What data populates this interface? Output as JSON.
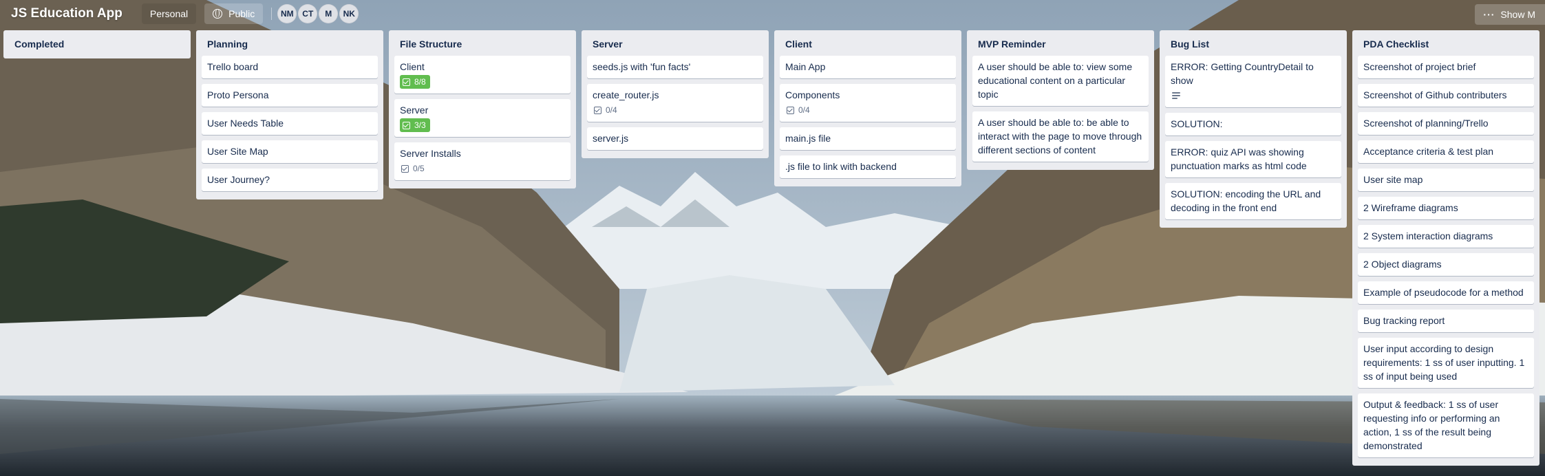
{
  "header": {
    "board_title": "JS Education App",
    "personal_label": "Personal",
    "visibility_label": "Public",
    "visibility_icon": "globe-icon",
    "members": [
      "NM",
      "CT",
      "M",
      "NK"
    ],
    "show_menu_label": "Show M"
  },
  "colors": {
    "list_bg": "#ebecf0",
    "card_bg": "#ffffff",
    "text": "#172b4d",
    "checklist_complete": "#61bd4f"
  },
  "lists": [
    {
      "title": "Completed",
      "cards": []
    },
    {
      "title": "Planning",
      "cards": [
        {
          "text": "Trello board"
        },
        {
          "text": "Proto Persona"
        },
        {
          "text": "User Needs Table"
        },
        {
          "text": "User Site Map"
        },
        {
          "text": "User Journey?"
        }
      ]
    },
    {
      "title": "File Structure",
      "cards": [
        {
          "text": "Client",
          "checklist": "8/8",
          "complete": true
        },
        {
          "text": "Server",
          "checklist": "3/3",
          "complete": true
        },
        {
          "text": "Server Installs",
          "checklist": "0/5",
          "complete": false
        }
      ]
    },
    {
      "title": "Server",
      "cards": [
        {
          "text": "seeds.js with 'fun facts'"
        },
        {
          "text": "create_router.js",
          "checklist": "0/4",
          "complete": false
        },
        {
          "text": "server.js"
        }
      ]
    },
    {
      "title": "Client",
      "cards": [
        {
          "text": "Main App"
        },
        {
          "text": "Components",
          "checklist": "0/4",
          "complete": false
        },
        {
          "text": "main.js file"
        },
        {
          "text": ".js file to link with backend"
        }
      ]
    },
    {
      "title": "MVP Reminder",
      "cards": [
        {
          "text": "A user should be able to: view some educational content on a particular topic"
        },
        {
          "text": "A user should be able to: be able to interact with the page to move through different sections of content"
        }
      ]
    },
    {
      "title": "Bug List",
      "cards": [
        {
          "text": "ERROR: Getting CountryDetail to show",
          "description": true
        },
        {
          "text": "SOLUTION:"
        },
        {
          "text": "ERROR: quiz API was showing punctuation marks as html code"
        },
        {
          "text": "SOLUTION: encoding the URL and decoding in the front end"
        }
      ]
    },
    {
      "title": "PDA Checklist",
      "cards": [
        {
          "text": "Screenshot of project brief"
        },
        {
          "text": "Screenshot of Github contributers"
        },
        {
          "text": "Screenshot of planning/Trello"
        },
        {
          "text": "Acceptance criteria & test plan"
        },
        {
          "text": "User site map"
        },
        {
          "text": "2 Wireframe diagrams"
        },
        {
          "text": "2 System interaction diagrams"
        },
        {
          "text": "2 Object diagrams"
        },
        {
          "text": "Example of pseudocode for a method"
        },
        {
          "text": "Bug tracking report"
        },
        {
          "text": "User input according to design requirements: 1 ss of user inputting. 1 ss of input being used"
        },
        {
          "text": "Output & feedback: 1 ss of user requesting info or performing an action, 1 ss of the result being demonstrated"
        }
      ]
    }
  ]
}
